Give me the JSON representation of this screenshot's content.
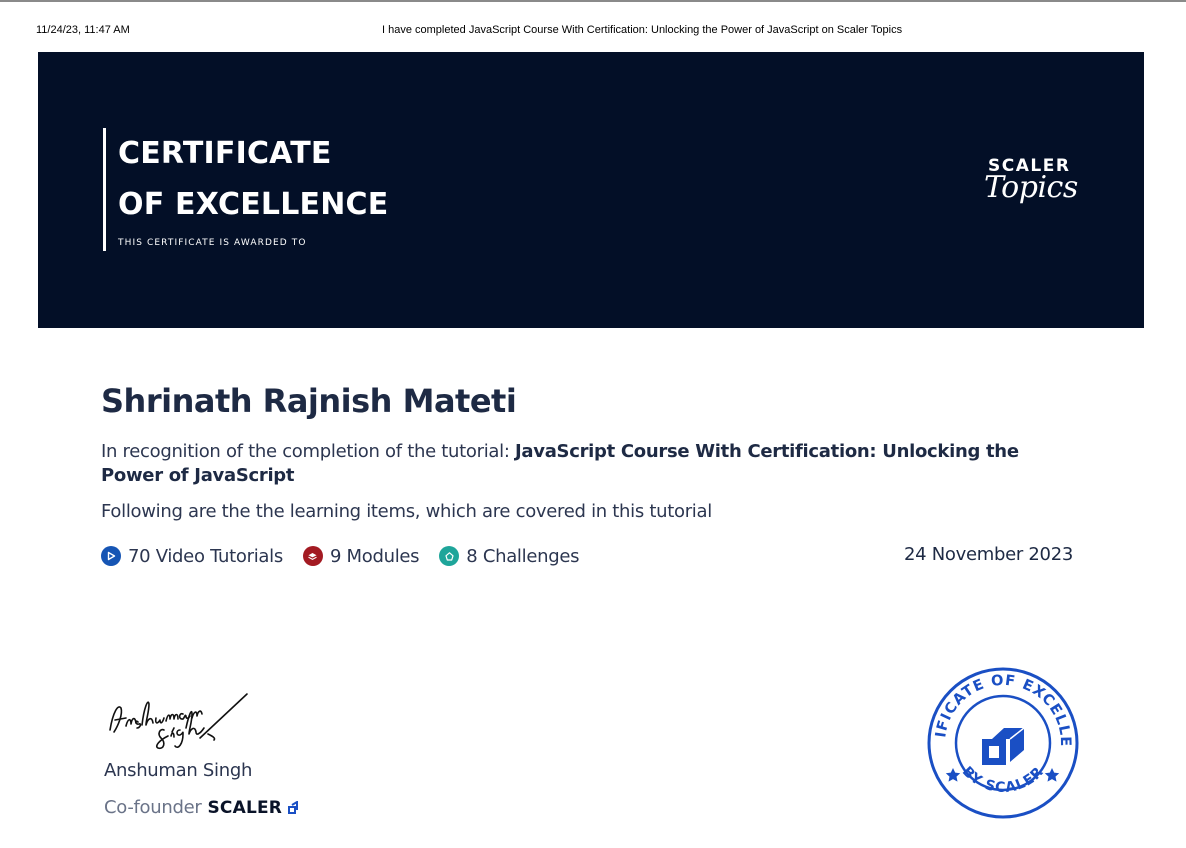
{
  "print_header": {
    "date": "11/24/23, 11:47 AM",
    "title": "I have completed JavaScript Course With Certification: Unlocking the Power of JavaScript on Scaler Topics"
  },
  "banner": {
    "title_line1": "CERTIFICATE",
    "title_line2": "OF EXCELLENCE",
    "subtitle": "THIS CERTIFICATE IS AWARDED TO",
    "brand_word": "SCALER",
    "brand_script": "Topics",
    "background_color": "#030f27"
  },
  "recipient": {
    "name": "Shrinath Rajnish Mateti"
  },
  "recognition": {
    "prefix": "In recognition of the completion of the tutorial: ",
    "course": "JavaScript Course With Certification: Unlocking the Power of JavaScript"
  },
  "following_text": "Following are the the learning items, which are covered in this tutorial",
  "stats": [
    {
      "icon": "play-icon",
      "label": "70 Video Tutorials",
      "color": "#1655b4"
    },
    {
      "icon": "layers-icon",
      "label": "9 Modules",
      "color": "#a31a22"
    },
    {
      "icon": "challenge-icon",
      "label": "8 Challenges",
      "color": "#1ea59a"
    }
  ],
  "date": "24 November 2023",
  "signatory": {
    "signature": "Anshuman Singh",
    "name": "Anshuman Singh",
    "role": "Co-founder",
    "company": "SCALER"
  },
  "seal": {
    "top_text": "CERTIFICATE OF EXCELLENCE",
    "bottom_text": "BY SCALER",
    "color": "#1a4fc4"
  }
}
